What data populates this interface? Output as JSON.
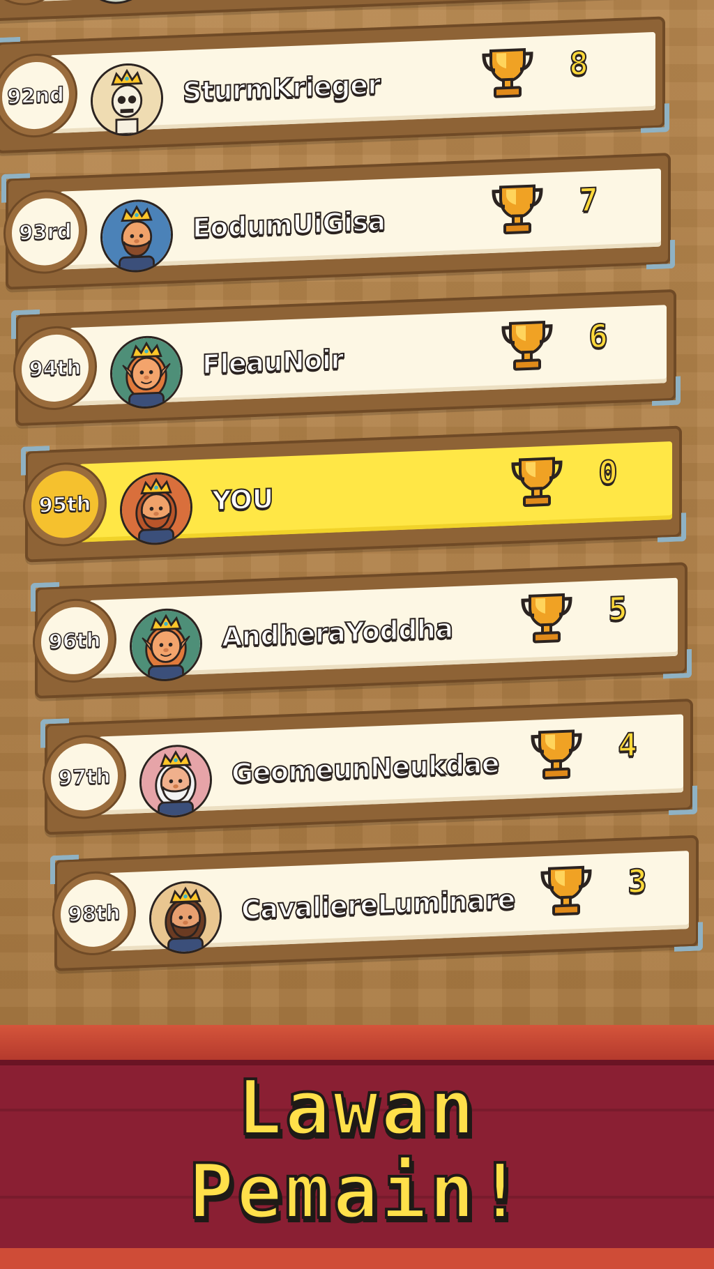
{
  "leaderboard": {
    "top_partial": {
      "rank": "",
      "name": "",
      "score": ""
    },
    "rows": [
      {
        "rank": "92nd",
        "name": "SturmKrieger",
        "score": "8",
        "avatar": "skeleton-king",
        "highlight": false
      },
      {
        "rank": "93rd",
        "name": "EodumUiGisa",
        "score": "7",
        "avatar": "bald-bearded-king",
        "highlight": false
      },
      {
        "rank": "94th",
        "name": "FleauNoir",
        "score": "6",
        "avatar": "elf-queen",
        "highlight": false
      },
      {
        "rank": "95th",
        "name": "YOU",
        "score": "0",
        "avatar": "red-bearded-king",
        "highlight": true
      },
      {
        "rank": "96th",
        "name": "AndheraYoddha",
        "score": "5",
        "avatar": "elf-queen",
        "highlight": false
      },
      {
        "rank": "97th",
        "name": "GeomeunNeukdae",
        "score": "4",
        "avatar": "old-white-bearded-king",
        "highlight": false
      },
      {
        "rank": "98th",
        "name": "CavaliereLuminare",
        "score": "3",
        "avatar": "mustached-king",
        "highlight": false
      }
    ]
  },
  "banner": {
    "line1": "Lawan",
    "line2": "Pemain!"
  },
  "colors": {
    "board_bg": "#b07f45",
    "panel": "#fdf7e4",
    "highlight": "#ffe746",
    "score": "#ffd93a",
    "banner": "#8a1f33",
    "banner_title": "#ffe04a"
  }
}
